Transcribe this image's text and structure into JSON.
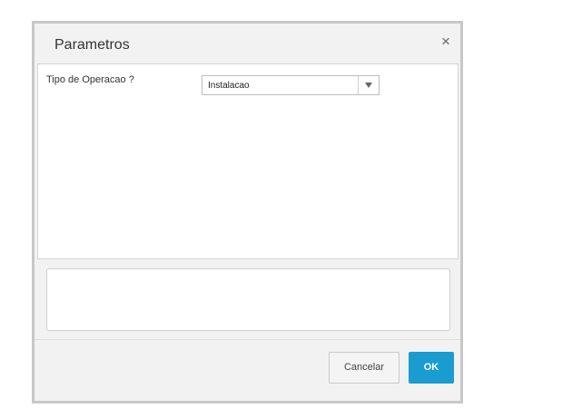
{
  "dialog": {
    "title": "Parametros",
    "close_icon": "close-icon",
    "close_glyph": "×"
  },
  "form": {
    "operation_type_label": "Tipo de Operacao ?",
    "operation_type_value": "Instalacao",
    "operation_type_icon": "chevron-down-icon"
  },
  "footer": {
    "cancel_label": "Cancelar",
    "ok_label": "OK"
  },
  "colors": {
    "ok_button": "#1a9cd0",
    "dialog_border": "#c8c8c8",
    "dialog_background": "#f2f2f2"
  }
}
